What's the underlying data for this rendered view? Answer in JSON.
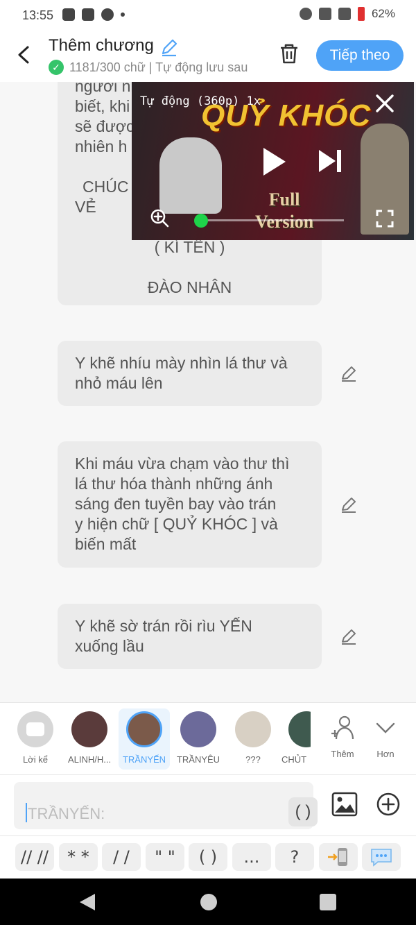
{
  "status_bar": {
    "time": "13:55",
    "battery_text": "62%"
  },
  "header": {
    "title": "Thêm chương",
    "subtitle": "1181/300 chữ | Tự động lưu sau",
    "next_label": "Tiếp theo"
  },
  "story_blocks": [
    {
      "lines": [
        "người nhận thông tin hoặc",
        "biết, khi",
        "sẽ được",
        "nhiên h",
        "",
        "CHÚC",
        "VẺ",
        "( KÍ TÊN )",
        "ĐÀO NHÂN"
      ]
    },
    {
      "lines": [
        "Y khẽ nhíu mày nhìn lá thư và",
        "nhỏ máu lên"
      ]
    },
    {
      "lines": [
        "Khi máu vừa chạm vào thư thì",
        "lá thư hóa thành những ánh",
        "sáng đen tuyền bay vào trán",
        "y hiện chữ [ QUỶ KHÓC ] và",
        "biến mất"
      ]
    },
    {
      "lines": [
        "Y khẽ sờ trán rồi rìu YẾN",
        "xuống lầu"
      ]
    }
  ],
  "video": {
    "auto_label": "Tự động (360p)  1x",
    "title": "QUỶ KHÓC",
    "full_text": "Full",
    "version_text": "Version",
    "progress": 0.02
  },
  "characters": [
    {
      "name": "Lời kể",
      "icon": "narration-icon",
      "color": "#d7d7d7"
    },
    {
      "name": "ALINH/H...",
      "icon": "avatar",
      "color": "#5a3b3b"
    },
    {
      "name": "TRẦNYẾN",
      "icon": "avatar",
      "color": "#7b5a4a",
      "selected": true
    },
    {
      "name": "TRẦNYÊU",
      "icon": "avatar",
      "color": "#6c6a9a"
    },
    {
      "name": "???",
      "icon": "avatar",
      "color": "#d8d0c4"
    },
    {
      "name": "CHỦT",
      "icon": "avatar",
      "color": "#3f5a4f"
    }
  ],
  "char_actions": {
    "add_label": "Thêm",
    "more_label": "Hơn"
  },
  "input": {
    "placeholder": "TRẦNYẾN:",
    "paren_label": "( )"
  },
  "symbols": [
    "// //",
    "* *",
    "/ /",
    "\" \"",
    "( )",
    "...",
    "?"
  ]
}
